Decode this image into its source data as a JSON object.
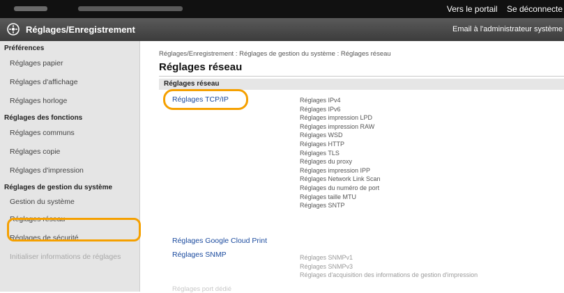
{
  "topbar": {
    "portal_link": "Vers le portail",
    "logout_link": "Se déconnecte"
  },
  "titlebar": {
    "title": "Réglages/Enregistrement",
    "admin_link": "Email à l'administrateur système"
  },
  "sidebar": {
    "sections": [
      {
        "heading": "Préférences",
        "items": [
          "Réglages papier",
          "Réglages d'affichage",
          "Réglages horloge"
        ]
      },
      {
        "heading": "Réglages des fonctions",
        "items": [
          "Réglages communs",
          "Réglages copie",
          "Réglages d'impression"
        ]
      },
      {
        "heading": "Réglages de gestion du système",
        "items": [
          "Gestion du système",
          "Réglages réseau",
          "Réglages de sécurité",
          "Initialiser informations de réglages"
        ]
      }
    ],
    "selected": "Réglages réseau"
  },
  "main": {
    "breadcrumb": "Réglages/Enregistrement : Réglages de gestion du système : Réglages réseau",
    "title": "Réglages réseau",
    "section_heading": "Réglages réseau",
    "tcp_link": "Réglages TCP/IP",
    "tcp_items": [
      "Réglages IPv4",
      "Réglages IPv6",
      "Réglages impression LPD",
      "Réglages impression RAW",
      "Réglages WSD",
      "Réglages HTTP",
      "Réglages TLS",
      "Réglages du proxy",
      "Réglages impression IPP",
      "Réglages Network Link Scan",
      "Réglages du numéro de port",
      "Réglages taille MTU",
      "Réglages SNTP"
    ],
    "google_link": "Réglages Google Cloud Print",
    "snmp_link": "Réglages SNMP",
    "snmp_items": [
      "Réglages SNMPv1",
      "Réglages SNMPv3",
      "Réglages d'acquisition des informations de gestion d'impression"
    ],
    "faint_link": "Réglages port dédié"
  },
  "colors": {
    "highlight_ring": "#f5a000",
    "link": "#1a4a9e"
  }
}
